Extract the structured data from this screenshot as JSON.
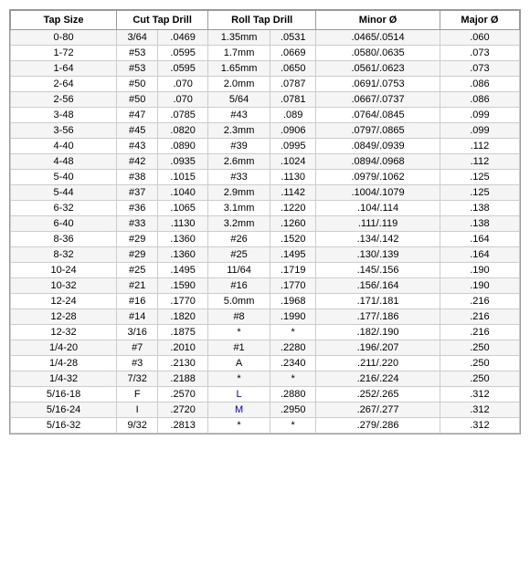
{
  "headers": {
    "tapSize": "Tap Size",
    "cutTapDrill": "Cut Tap Drill",
    "rollTapDrill": "Roll Tap Drill",
    "minorD": "Minor Ø",
    "majorD": "Major Ø"
  },
  "rows": [
    {
      "tap": "0-80",
      "cut1": "3/64",
      "cut2": ".0469",
      "roll1": "1.35mm",
      "roll2": ".0531",
      "minor": ".0465/.0514",
      "major": ".060",
      "blueRoll1": false,
      "blueRoll2": false
    },
    {
      "tap": "1-72",
      "cut1": "#53",
      "cut2": ".0595",
      "roll1": "1.7mm",
      "roll2": ".0669",
      "minor": ".0580/.0635",
      "major": ".073",
      "blueRoll1": false,
      "blueRoll2": false
    },
    {
      "tap": "1-64",
      "cut1": "#53",
      "cut2": ".0595",
      "roll1": "1.65mm",
      "roll2": ".0650",
      "minor": ".0561/.0623",
      "major": ".073",
      "blueRoll1": false,
      "blueRoll2": false
    },
    {
      "tap": "2-64",
      "cut1": "#50",
      "cut2": ".070",
      "roll1": "2.0mm",
      "roll2": ".0787",
      "minor": ".0691/.0753",
      "major": ".086",
      "blueRoll1": false,
      "blueRoll2": false
    },
    {
      "tap": "2-56",
      "cut1": "#50",
      "cut2": ".070",
      "roll1": "5/64",
      "roll2": ".0781",
      "minor": ".0667/.0737",
      "major": ".086",
      "blueRoll1": false,
      "blueRoll2": false
    },
    {
      "tap": "3-48",
      "cut1": "#47",
      "cut2": ".0785",
      "roll1": "#43",
      "roll2": ".089",
      "minor": ".0764/.0845",
      "major": ".099",
      "blueRoll1": false,
      "blueRoll2": false
    },
    {
      "tap": "3-56",
      "cut1": "#45",
      "cut2": ".0820",
      "roll1": "2.3mm",
      "roll2": ".0906",
      "minor": ".0797/.0865",
      "major": ".099",
      "blueRoll1": false,
      "blueRoll2": false
    },
    {
      "tap": "4-40",
      "cut1": "#43",
      "cut2": ".0890",
      "roll1": "#39",
      "roll2": ".0995",
      "minor": ".0849/.0939",
      "major": ".112",
      "blueRoll1": false,
      "blueRoll2": false
    },
    {
      "tap": "4-48",
      "cut1": "#42",
      "cut2": ".0935",
      "roll1": "2.6mm",
      "roll2": ".1024",
      "minor": ".0894/.0968",
      "major": ".112",
      "blueRoll1": false,
      "blueRoll2": false
    },
    {
      "tap": "5-40",
      "cut1": "#38",
      "cut2": ".1015",
      "roll1": "#33",
      "roll2": ".1130",
      "minor": ".0979/.1062",
      "major": ".125",
      "blueRoll1": false,
      "blueRoll2": false
    },
    {
      "tap": "5-44",
      "cut1": "#37",
      "cut2": ".1040",
      "roll1": "2.9mm",
      "roll2": ".1142",
      "minor": ".1004/.1079",
      "major": ".125",
      "blueRoll1": false,
      "blueRoll2": false
    },
    {
      "tap": "6-32",
      "cut1": "#36",
      "cut2": ".1065",
      "roll1": "3.1mm",
      "roll2": ".1220",
      "minor": ".104/.114",
      "major": ".138",
      "blueRoll1": false,
      "blueRoll2": false
    },
    {
      "tap": "6-40",
      "cut1": "#33",
      "cut2": ".1130",
      "roll1": "3.2mm",
      "roll2": ".1260",
      "minor": ".111/.119",
      "major": ".138",
      "blueRoll1": false,
      "blueRoll2": false
    },
    {
      "tap": "8-36",
      "cut1": "#29",
      "cut2": ".1360",
      "roll1": "#26",
      "roll2": ".1520",
      "minor": ".134/.142",
      "major": ".164",
      "blueRoll1": false,
      "blueRoll2": false
    },
    {
      "tap": "8-32",
      "cut1": "#29",
      "cut2": ".1360",
      "roll1": "#25",
      "roll2": ".1495",
      "minor": ".130/.139",
      "major": ".164",
      "blueRoll1": false,
      "blueRoll2": false
    },
    {
      "tap": "10-24",
      "cut1": "#25",
      "cut2": ".1495",
      "roll1": "11/64",
      "roll2": ".1719",
      "minor": ".145/.156",
      "major": ".190",
      "blueRoll1": false,
      "blueRoll2": false
    },
    {
      "tap": "10-32",
      "cut1": "#21",
      "cut2": ".1590",
      "roll1": "#16",
      "roll2": ".1770",
      "minor": ".156/.164",
      "major": ".190",
      "blueRoll1": false,
      "blueRoll2": false
    },
    {
      "tap": "12-24",
      "cut1": "#16",
      "cut2": ".1770",
      "roll1": "5.0mm",
      "roll2": ".1968",
      "minor": ".171/.181",
      "major": ".216",
      "blueRoll1": false,
      "blueRoll2": false
    },
    {
      "tap": "12-28",
      "cut1": "#14",
      "cut2": ".1820",
      "roll1": "#8",
      "roll2": ".1990",
      "minor": ".177/.186",
      "major": ".216",
      "blueRoll1": false,
      "blueRoll2": false
    },
    {
      "tap": "12-32",
      "cut1": "3/16",
      "cut2": ".1875",
      "roll1": "*",
      "roll2": "*",
      "minor": ".182/.190",
      "major": ".216",
      "blueRoll1": false,
      "blueRoll2": false
    },
    {
      "tap": "1/4-20",
      "cut1": "#7",
      "cut2": ".2010",
      "roll1": "#1",
      "roll2": ".2280",
      "minor": ".196/.207",
      "major": ".250",
      "blueRoll1": false,
      "blueRoll2": false
    },
    {
      "tap": "1/4-28",
      "cut1": "#3",
      "cut2": ".2130",
      "roll1": "A",
      "roll2": ".2340",
      "minor": ".211/.220",
      "major": ".250",
      "blueRoll1": false,
      "blueRoll2": false
    },
    {
      "tap": "1/4-32",
      "cut1": "7/32",
      "cut2": ".2188",
      "roll1": "*",
      "roll2": "*",
      "minor": ".216/.224",
      "major": ".250",
      "blueRoll1": false,
      "blueRoll2": false
    },
    {
      "tap": "5/16-18",
      "cut1": "F",
      "cut2": ".2570",
      "roll1": "L",
      "roll2": ".2880",
      "minor": ".252/.265",
      "major": ".312",
      "blueRoll1": true,
      "blueRoll2": false
    },
    {
      "tap": "5/16-24",
      "cut1": "I",
      "cut2": ".2720",
      "roll1": "M",
      "roll2": ".2950",
      "minor": ".267/.277",
      "major": ".312",
      "blueRoll1": true,
      "blueRoll2": false
    },
    {
      "tap": "5/16-32",
      "cut1": "9/32",
      "cut2": ".2813",
      "roll1": "*",
      "roll2": "*",
      "minor": ".279/.286",
      "major": ".312",
      "blueRoll1": false,
      "blueRoll2": false
    }
  ]
}
